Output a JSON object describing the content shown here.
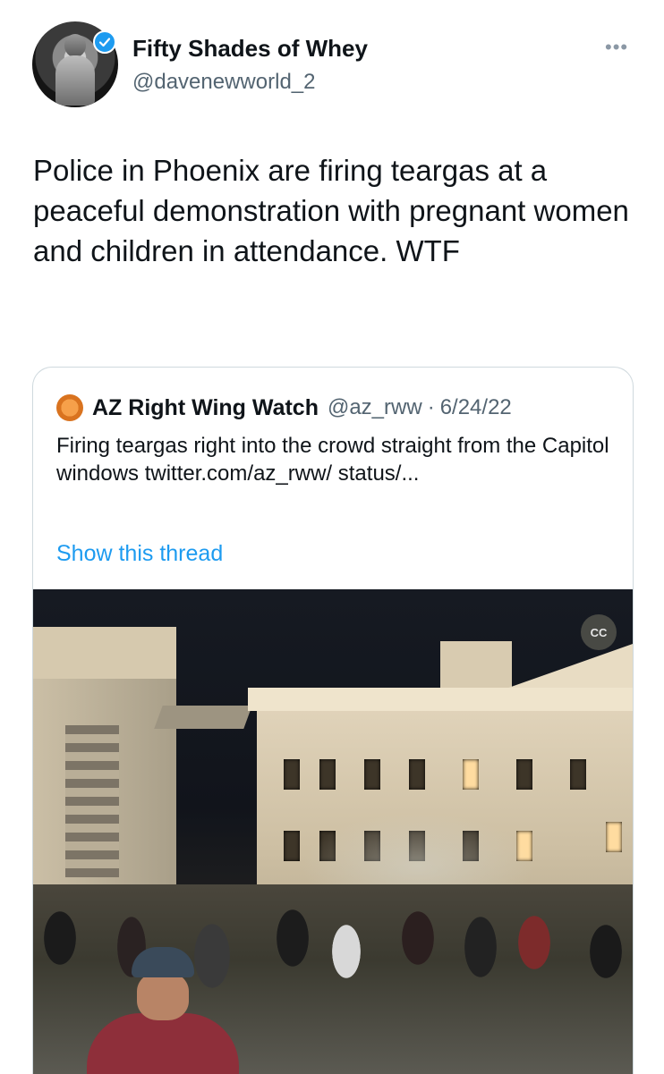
{
  "tweet": {
    "author": {
      "display_name": "Fifty Shades of Whey",
      "handle": "@davenewworld_2",
      "verified": true
    },
    "text": "Police in Phoenix are firing teargas at a peaceful demonstration with pregnant women and children in attendance. WTF",
    "more_icon": "ellipsis-icon"
  },
  "quoted_tweet": {
    "author": {
      "display_name": "AZ Right Wing Watch",
      "handle": "@az_rww",
      "separator": "·",
      "date": "6/24/22"
    },
    "text": "Firing teargas right into the crowd straight from the Capitol windows twitter.com/az_rww/ status/...",
    "show_thread": "Show this thread",
    "media": {
      "type": "video",
      "caption_badge": "CC"
    }
  },
  "colors": {
    "accent": "#1d9bf0",
    "secondary_text": "#536471",
    "border": "#cfd9de"
  }
}
